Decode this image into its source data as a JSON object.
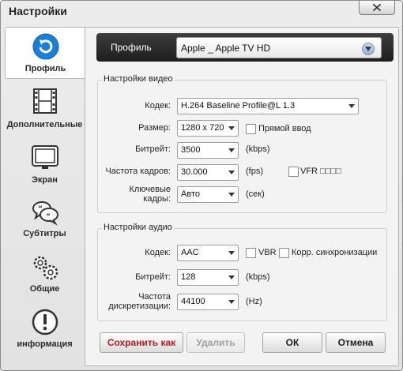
{
  "window": {
    "title": "Настройки"
  },
  "sidebar": {
    "items": [
      {
        "label": "Профиль",
        "icon": "refresh-icon",
        "active": true
      },
      {
        "label": "Дополнительные",
        "icon": "film-icon"
      },
      {
        "label": "Экран",
        "icon": "monitor-icon"
      },
      {
        "label": "Субтитры",
        "icon": "speech-bubbles-icon"
      },
      {
        "label": "Общие",
        "icon": "gears-icon"
      },
      {
        "label": "информация",
        "icon": "info-icon"
      }
    ]
  },
  "profile": {
    "label": "Профиль",
    "value": "Apple _ Apple TV HD"
  },
  "video": {
    "title": "Настройки видео",
    "codec_label": "Кодек:",
    "codec_value": "H.264 Baseline Profile@L 1.3",
    "size_label": "Размер:",
    "size_value": "1280 x 720",
    "direct_input_label": "Прямой ввод",
    "bitrate_label": "Битрейт:",
    "bitrate_value": "3500",
    "bitrate_unit": "(kbps)",
    "framerate_label": "Частота кадров:",
    "framerate_value": "30.000",
    "framerate_unit": "(fps)",
    "vfr_label": "VFR □□□□",
    "keyframes_label_1": "Ключевые",
    "keyframes_label_2": "кадры:",
    "keyframes_value": "Авто",
    "keyframes_unit": "(сек)"
  },
  "audio": {
    "title": "Настройки аудио",
    "codec_label": "Кодек:",
    "codec_value": "AAC",
    "vbr_label": "VBR",
    "sync_label": "Корр. синхронизации",
    "bitrate_label": "Битрейт:",
    "bitrate_value": "128",
    "bitrate_unit": "(kbps)",
    "samplerate_label_1": "Частота",
    "samplerate_label_2": "дискретизации:",
    "samplerate_value": "44100",
    "samplerate_unit": "(Hz)"
  },
  "buttons": {
    "save_as": "Сохранить как",
    "delete": "Удалить",
    "ok": "ОК",
    "cancel": "Отмена"
  },
  "colors": {
    "save_text": "#b22222",
    "profile_bar": "#2b2b2b"
  }
}
